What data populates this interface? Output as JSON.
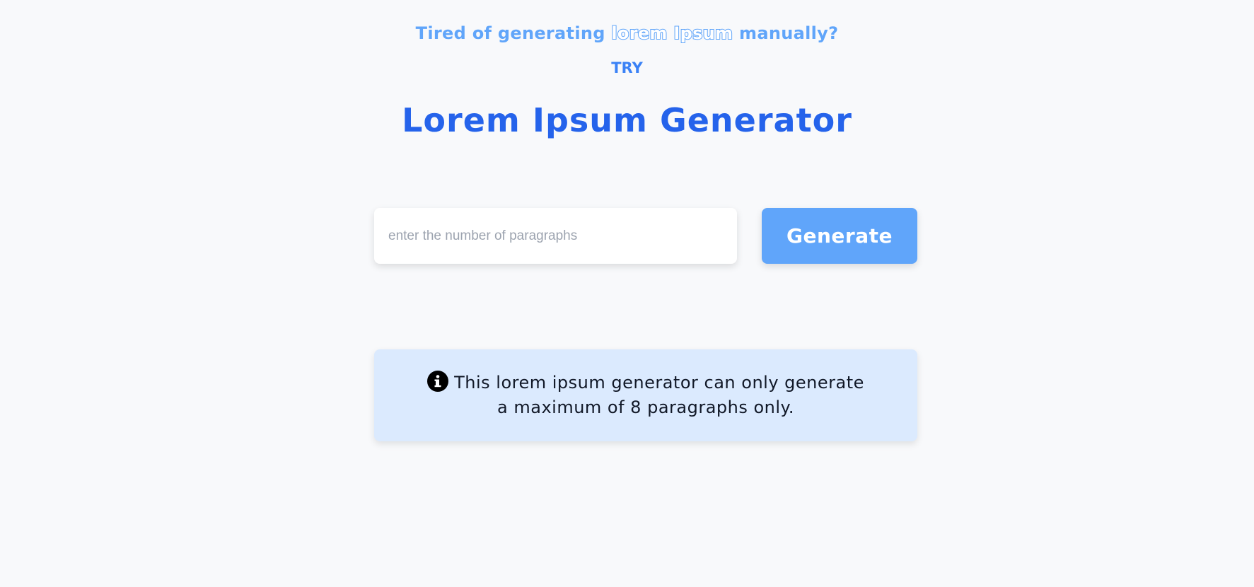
{
  "header": {
    "tagline_prefix": "Tired of generating ",
    "tagline_highlight": "lorem Ipsum",
    "tagline_suffix": " manually?",
    "try_label": "TRY",
    "title": "Lorem Ipsum Generator"
  },
  "form": {
    "input_value": "",
    "input_placeholder": "enter the number of paragraphs",
    "generate_label": "Generate"
  },
  "info": {
    "icon": "info-circle-icon",
    "message": "This lorem ipsum generator can only generate a maximum of 8 paragraphs only."
  },
  "colors": {
    "background": "#f8f9fb",
    "tagline": "#60a5fa",
    "title": "#2563eb",
    "button": "#60a5fa",
    "info_background": "#dbeafe"
  }
}
